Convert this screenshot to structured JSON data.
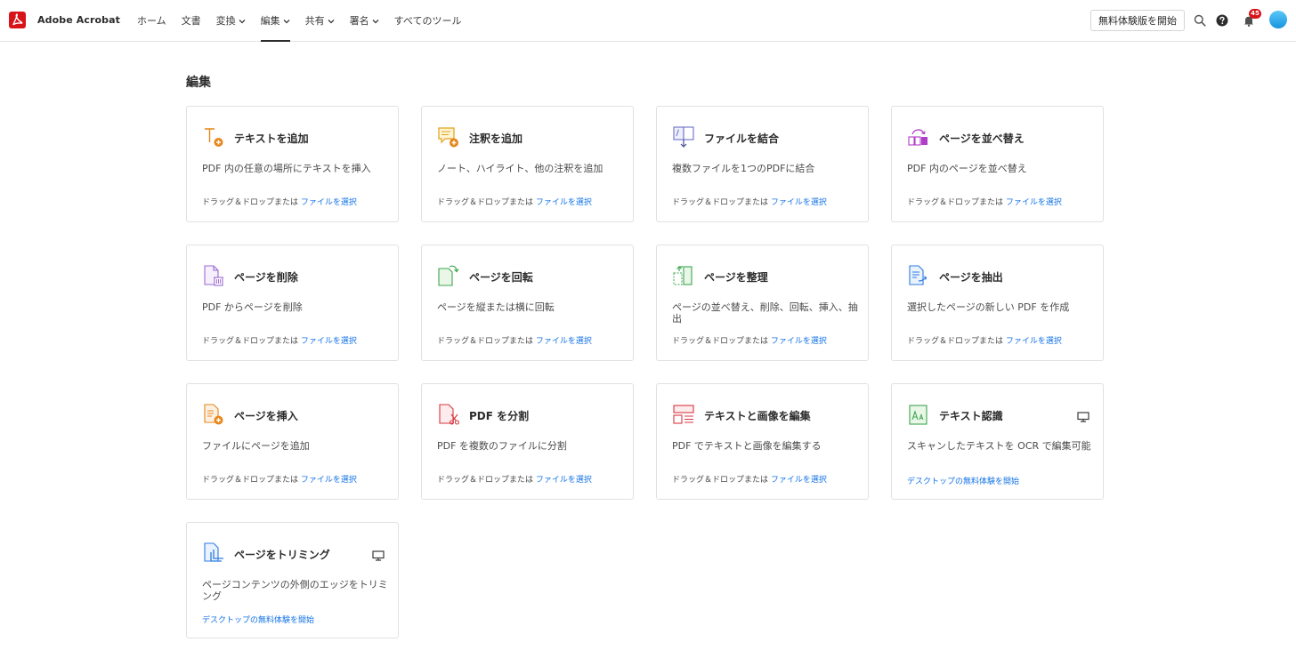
{
  "header": {
    "brand": "Adobe Acrobat",
    "nav": [
      {
        "label": "ホーム",
        "dropdown": false,
        "active": false
      },
      {
        "label": "文書",
        "dropdown": false,
        "active": false
      },
      {
        "label": "変換",
        "dropdown": true,
        "active": false
      },
      {
        "label": "編集",
        "dropdown": true,
        "active": true
      },
      {
        "label": "共有",
        "dropdown": true,
        "active": false
      },
      {
        "label": "署名",
        "dropdown": true,
        "active": false
      },
      {
        "label": "すべてのツール",
        "dropdown": false,
        "active": false
      }
    ],
    "trial_button": "無料体験版を開始",
    "notification_count": "45"
  },
  "main": {
    "section_title": "編集",
    "foot_prefix": "ドラッグ＆ドロップまたは",
    "foot_link": "ファイルを選択",
    "desktop_link": "デスクトップの無料体験を開始",
    "cards": [
      {
        "title": "テキストを追加",
        "desc": "PDF 内の任意の場所にテキストを挿入",
        "icon": "add-text-icon"
      },
      {
        "title": "注釈を追加",
        "desc": "ノート、ハイライト、他の注釈を追加",
        "icon": "add-comment-icon"
      },
      {
        "title": "ファイルを結合",
        "desc": "複数ファイルを1つのPDFに結合",
        "icon": "combine-files-icon"
      },
      {
        "title": "ページを並べ替え",
        "desc": "PDF 内のページを並べ替え",
        "icon": "reorder-pages-icon"
      },
      {
        "title": "ページを削除",
        "desc": "PDF からページを削除",
        "icon": "delete-pages-icon"
      },
      {
        "title": "ページを回転",
        "desc": "ページを縦または横に回転",
        "icon": "rotate-pages-icon"
      },
      {
        "title": "ページを整理",
        "desc": "ページの並べ替え、削除、回転、挿入、抽出",
        "icon": "organize-pages-icon"
      },
      {
        "title": "ページを抽出",
        "desc": "選択したページの新しい PDF を作成",
        "icon": "extract-pages-icon"
      },
      {
        "title": "ページを挿入",
        "desc": "ファイルにページを追加",
        "icon": "insert-pages-icon"
      },
      {
        "title": "PDF を分割",
        "desc": "PDF を複数のファイルに分割",
        "icon": "split-pdf-icon"
      },
      {
        "title": "テキストと画像を編集",
        "desc": "PDF でテキストと画像を編集する",
        "icon": "edit-text-images-icon"
      },
      {
        "title": "テキスト認識",
        "desc": "スキャンしたテキストを OCR で編集可能",
        "icon": "ocr-icon",
        "desktop_only": true
      },
      {
        "title": "ページをトリミング",
        "desc": "ページコンテンツの外側のエッジをトリミング",
        "icon": "crop-pages-icon",
        "desktop_only": true
      }
    ]
  },
  "colors": {
    "brand_red": "#d7141a",
    "link_blue": "#1473e6"
  }
}
